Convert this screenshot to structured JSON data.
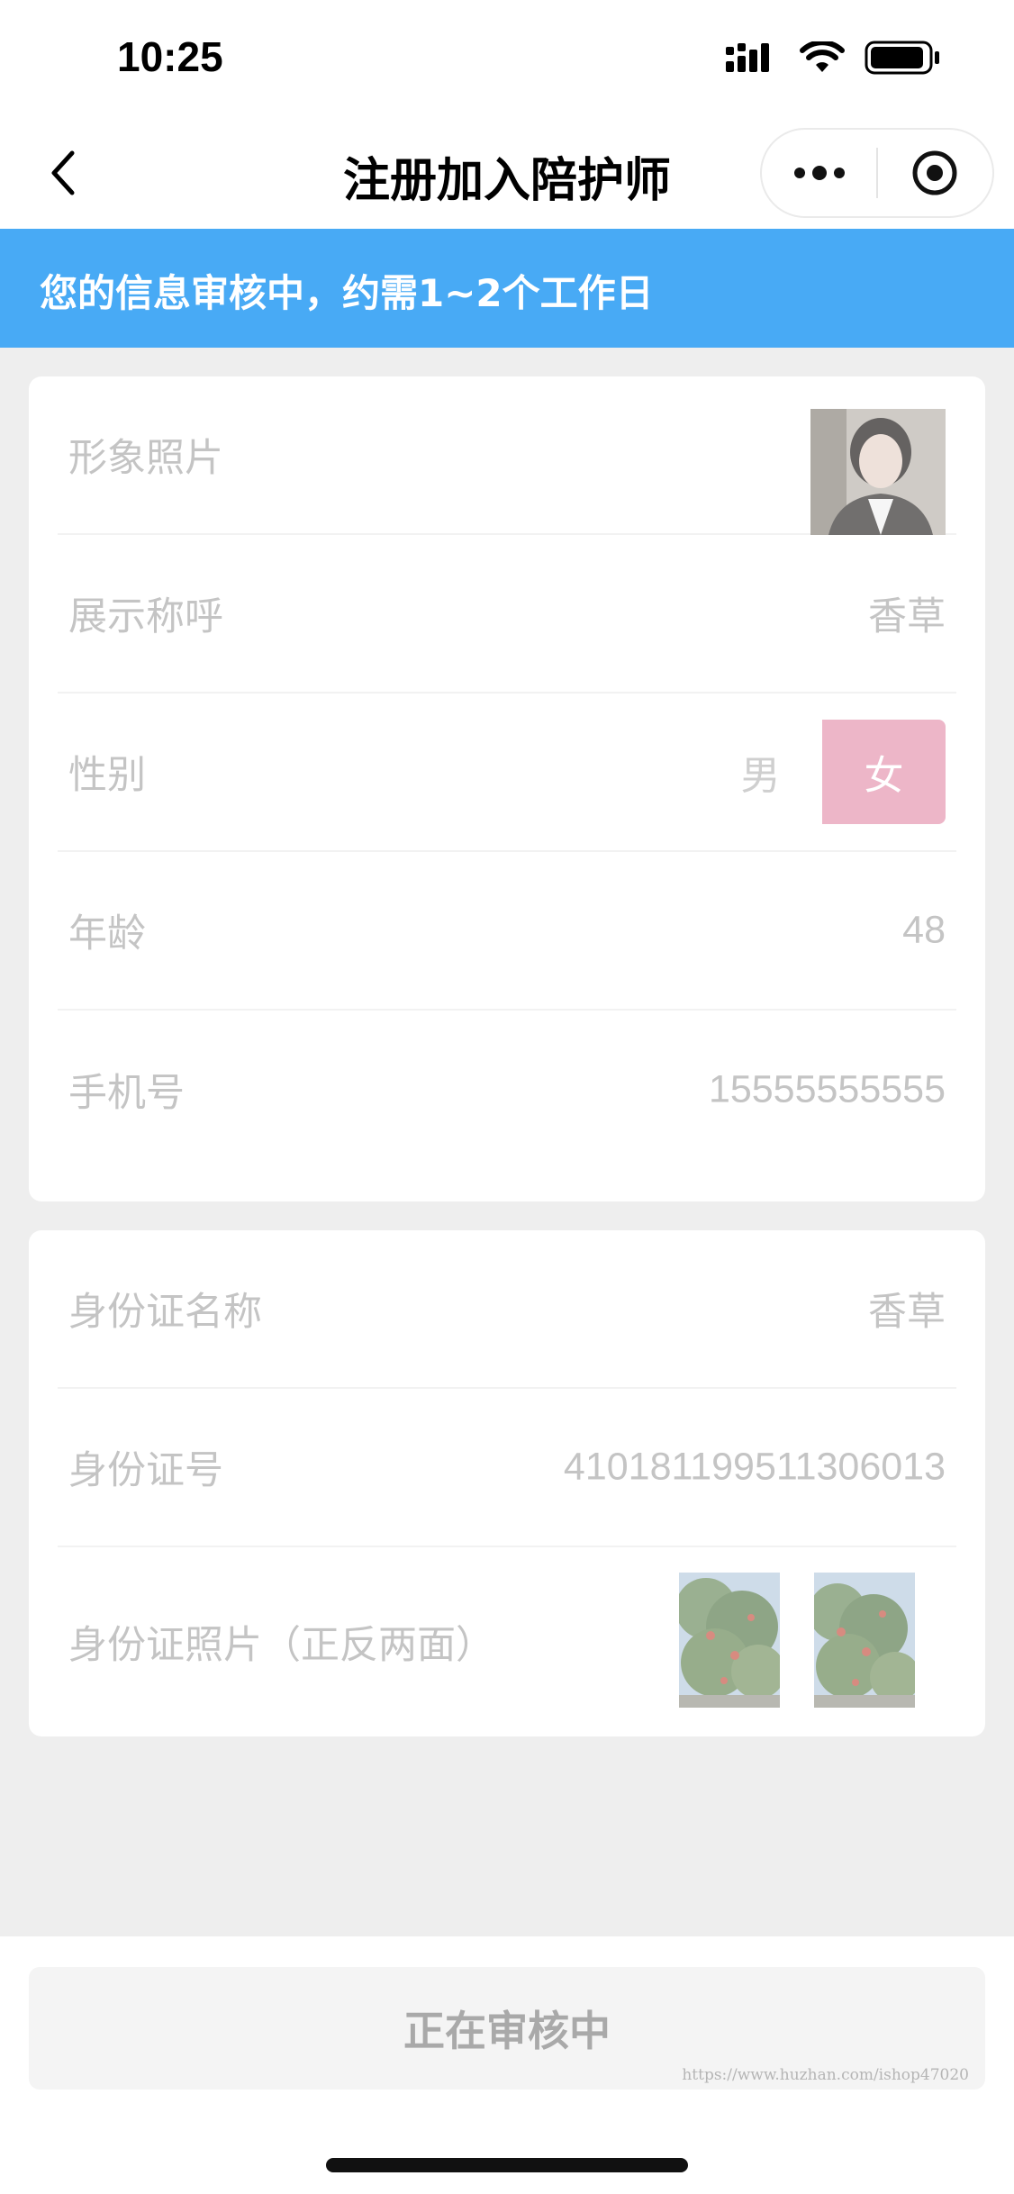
{
  "status_bar": {
    "time": "10:25"
  },
  "nav": {
    "title": "注册加入陪护师"
  },
  "notice": {
    "text": "您的信息审核中，约需1~2个工作日"
  },
  "profile": {
    "photo_label": "形象照片",
    "nickname_label": "展示称呼",
    "nickname_value": "香草",
    "gender_label": "性别",
    "gender_options": [
      "男",
      "女"
    ],
    "gender_selected": "女",
    "age_label": "年龄",
    "age_value": "48",
    "phone_label": "手机号",
    "phone_value": "15555555555"
  },
  "identity": {
    "name_label": "身份证名称",
    "name_value": "香草",
    "number_label": "身份证号",
    "number_value": "410181199511306013",
    "photos_label": "身份证照片（正反两面）"
  },
  "footer": {
    "button_label": "正在审核中",
    "watermark": "https://www.huzhan.com/ishop47020"
  },
  "colors": {
    "notice_bg": "#48aaf5",
    "gender_selected_bg": "#edb6c8",
    "page_bg": "#eeeeee"
  }
}
